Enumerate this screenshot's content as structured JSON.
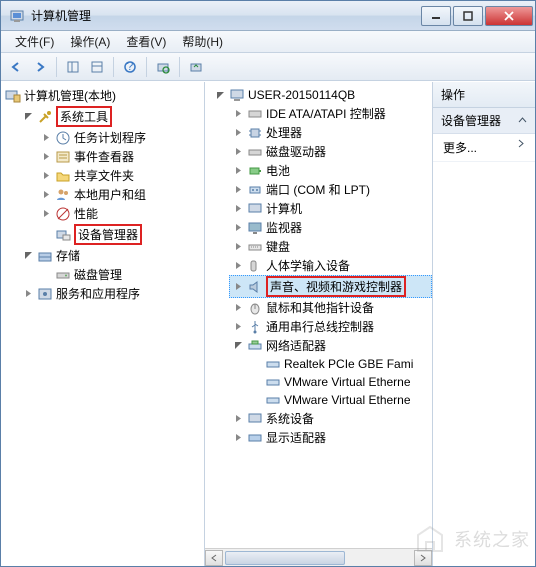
{
  "window": {
    "title": "计算机管理"
  },
  "menu": {
    "file": "文件(F)",
    "action": "操作(A)",
    "view": "查看(V)",
    "help": "帮助(H)"
  },
  "leftTree": {
    "root": "计算机管理(本地)",
    "systools": "系统工具",
    "systoolsItems": {
      "task": "任务计划程序",
      "event": "事件查看器",
      "shared": "共享文件夹",
      "users": "本地用户和组",
      "perf": "性能",
      "devmgr": "设备管理器"
    },
    "storage": "存储",
    "storageItems": {
      "diskmgmt": "磁盘管理"
    },
    "services": "服务和应用程序"
  },
  "midTree": {
    "root": "USER-20150114QB",
    "items": {
      "ide": "IDE ATA/ATAPI 控制器",
      "cpu": "处理器",
      "disk": "磁盘驱动器",
      "battery": "电池",
      "port": "端口 (COM 和 LPT)",
      "computer": "计算机",
      "monitor": "监视器",
      "keyboard": "键盘",
      "hid": "人体学输入设备",
      "sound": "声音、视频和游戏控制器",
      "mouse": "鼠标和其他指针设备",
      "usb": "通用串行总线控制器",
      "net": "网络适配器",
      "netChildren": {
        "n1": "Realtek PCIe GBE Fami",
        "n2": "VMware Virtual Etherne",
        "n3": "VMware Virtual Etherne"
      },
      "sysdev": "系统设备",
      "display": "显示适配器"
    }
  },
  "actions": {
    "header": "操作",
    "selected": "设备管理器",
    "more": "更多..."
  },
  "watermark": "系统之家"
}
